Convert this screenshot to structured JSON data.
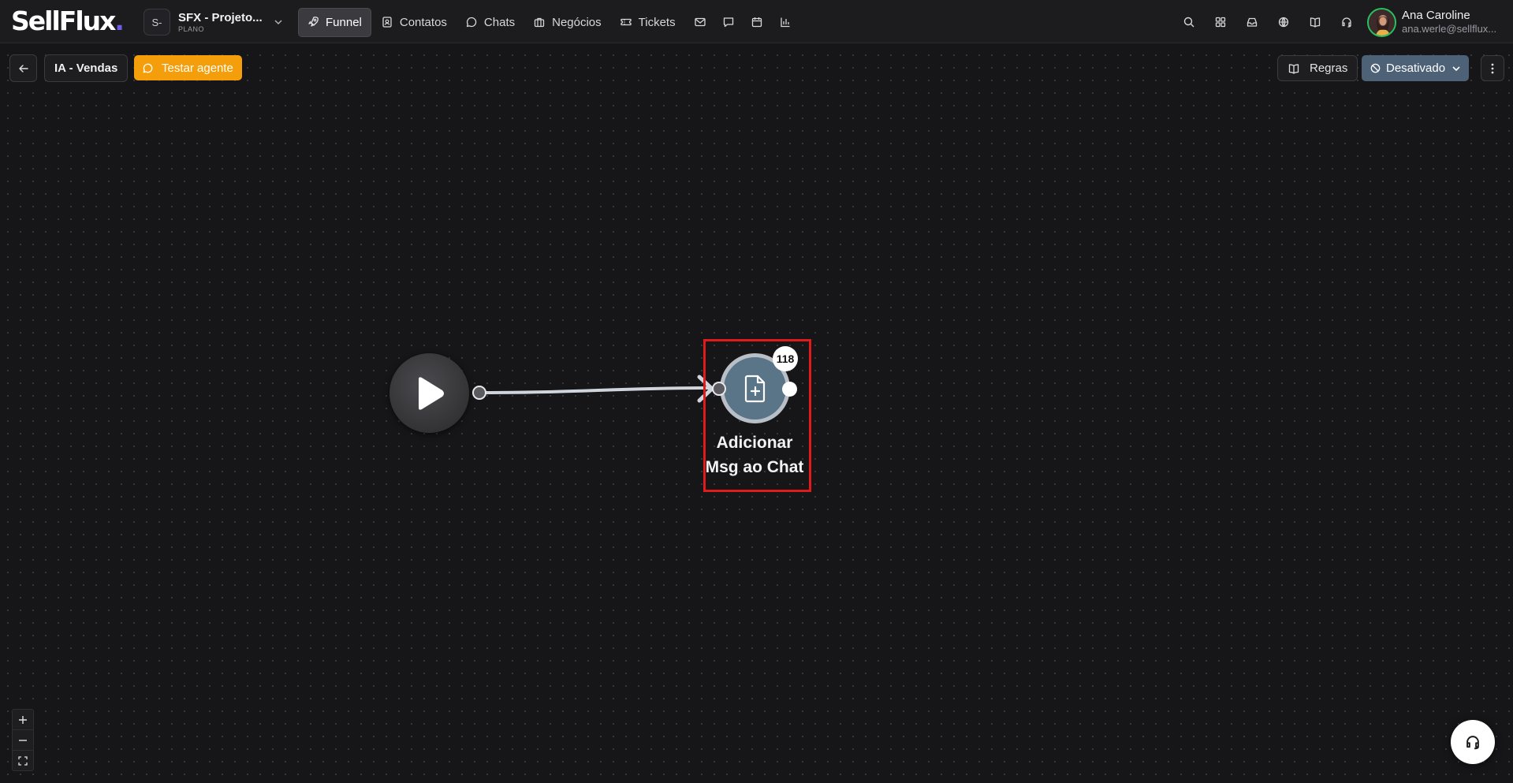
{
  "app": {
    "logo_text": "SellFlux",
    "logo_dot": "."
  },
  "project": {
    "avatar_text": "S-",
    "name": "SFX - Projeto...",
    "plan": "PLANO"
  },
  "nav": {
    "items": [
      {
        "label": "Funnel",
        "icon": "rocket-icon",
        "active": true
      },
      {
        "label": "Contatos",
        "icon": "contacts-icon",
        "active": false
      },
      {
        "label": "Chats",
        "icon": "chat-bubble-icon",
        "active": false
      },
      {
        "label": "Negócios",
        "icon": "briefcase-icon",
        "active": false
      },
      {
        "label": "Tickets",
        "icon": "ticket-icon",
        "active": false
      }
    ],
    "icon_only": [
      "mail-icon",
      "message-square-icon",
      "calendar-icon",
      "bar-chart-icon"
    ]
  },
  "header_icons": [
    "search-icon",
    "apps-grid-icon",
    "inbox-icon",
    "globe-icon",
    "book-open-icon",
    "headset-icon"
  ],
  "user": {
    "name": "Ana Caroline",
    "email": "ana.werle@sellflux..."
  },
  "toolbar": {
    "flow_name": "IA - Vendas",
    "test_label": "Testar agente",
    "rules_label": "Regras",
    "status_label": "Desativado"
  },
  "flow": {
    "start_node_icon": "play-icon",
    "action_node": {
      "icon": "file-plus-icon",
      "badge_count": "118",
      "label_line1": "Adicionar",
      "label_line2": "Msg ao Chat"
    }
  },
  "colors": {
    "background": "#161618",
    "accent_orange": "#f59e0b",
    "status_blue": "#4d6177",
    "node_fill": "#5a7488",
    "highlight_red": "#e01b1b",
    "online_green": "#22c55e"
  }
}
